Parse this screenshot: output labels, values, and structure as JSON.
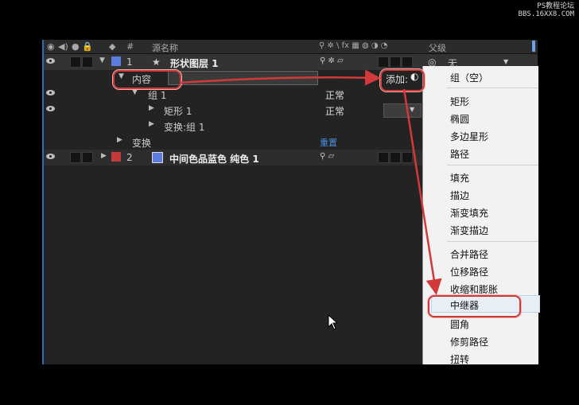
{
  "watermark": {
    "line1": "PS教程论坛",
    "line2": "BBS.16XX8.COM"
  },
  "header": {
    "number": "#",
    "source_name": "源名称",
    "switch_icons": "⚲ ✲ \\ fx ▦ ◍ ◑ ◔",
    "parent": "父级"
  },
  "layers": [
    {
      "index": "1",
      "name": "形状图层 1",
      "color": "#5d7ce0",
      "parent": "无"
    },
    {
      "index": "2",
      "name": "中间色品蓝色 纯色 1",
      "color": "#c23a3a"
    }
  ],
  "tree": {
    "contents": "内容",
    "add_label": "添加:",
    "group": "组 1",
    "rect": "矩形 1",
    "transform_group": "变换:组 1",
    "transform": "变换",
    "reset": "重置",
    "mode1": "正常",
    "mode2": "正常"
  },
  "menu": {
    "items": [
      "组（空）",
      "矩形",
      "椭圆",
      "多边星形",
      "路径",
      "填充",
      "描边",
      "渐变填充",
      "渐变描边",
      "合并路径",
      "位移路径",
      "收缩和膨胀",
      "中继器",
      "圆角",
      "修剪路径",
      "扭转"
    ],
    "highlighted": "中继器"
  },
  "colors": {
    "annotation": "#d23a3a",
    "accent": "#2a6fb3"
  }
}
